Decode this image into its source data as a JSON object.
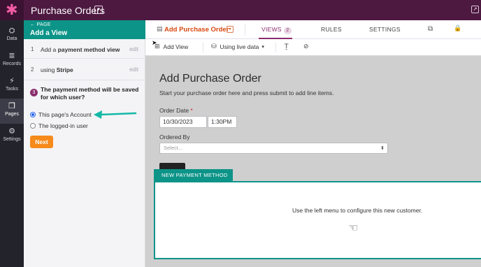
{
  "topbar": {
    "title": "Purchase Orders",
    "title_caret": "▾",
    "exit_icon": "↗"
  },
  "logo": "✱",
  "leftnav": {
    "items": [
      {
        "icon": "⛭",
        "label": "Data"
      },
      {
        "icon": "≣",
        "label": "Records"
      },
      {
        "icon": "⚡",
        "label": "Tasks"
      },
      {
        "icon": "❐",
        "label": "Pages"
      },
      {
        "icon": "⚙",
        "label": "Settings"
      }
    ]
  },
  "panel": {
    "back_label": "← PAGE",
    "title": "Add a View",
    "steps": [
      {
        "num": "1",
        "prefix": "Add a ",
        "bold": "payment method view",
        "edit": "edit"
      },
      {
        "num": "2",
        "prefix": "using ",
        "bold": "Stripe",
        "edit": "edit"
      },
      {
        "num": "3"
      }
    ],
    "question": "The payment method will be saved for which user?",
    "options": [
      {
        "label": "This page's Account",
        "selected": true
      },
      {
        "label": "The logged-in user",
        "selected": false
      }
    ],
    "next_label": "Next"
  },
  "tabs": {
    "doc_icon": "▤",
    "view_title": "Add Purchase Order",
    "view_caret": "▾",
    "views_label": "VIEWS",
    "views_count": "2",
    "rules_label": "RULES",
    "settings_label": "SETTINGS",
    "external_icon": "⧉",
    "lock_icon": "🔒"
  },
  "toolbar": {
    "add_view_icon": "⊞",
    "add_view_label": "Add View",
    "live_data_icon": "⛁",
    "live_data_label": "Using live data",
    "live_data_caret": "▾",
    "text_icon": "Ṯ",
    "hide_icon": "⊘"
  },
  "form": {
    "title": "Add Purchase Order",
    "subtitle": "Start your purchase order here and press submit to add line items.",
    "order_date_label": "Order Date",
    "required_mark": "*",
    "date_value": "10/30/2023",
    "time_value": "1:30PM",
    "ordered_by_label": "Ordered By",
    "ordered_by_placeholder": "Select...",
    "select_caret": "⬍"
  },
  "new_payment": {
    "tab_label": "NEW PAYMENT METHOD",
    "message": "Use the left menu to configure this new customer.",
    "pointer_icon": "☜"
  },
  "colors": {
    "brand": "#4d1941",
    "accent": "#0d9488",
    "primary": "#8b2d6e",
    "action": "#f68a1b",
    "view_title": "#d9480f"
  }
}
